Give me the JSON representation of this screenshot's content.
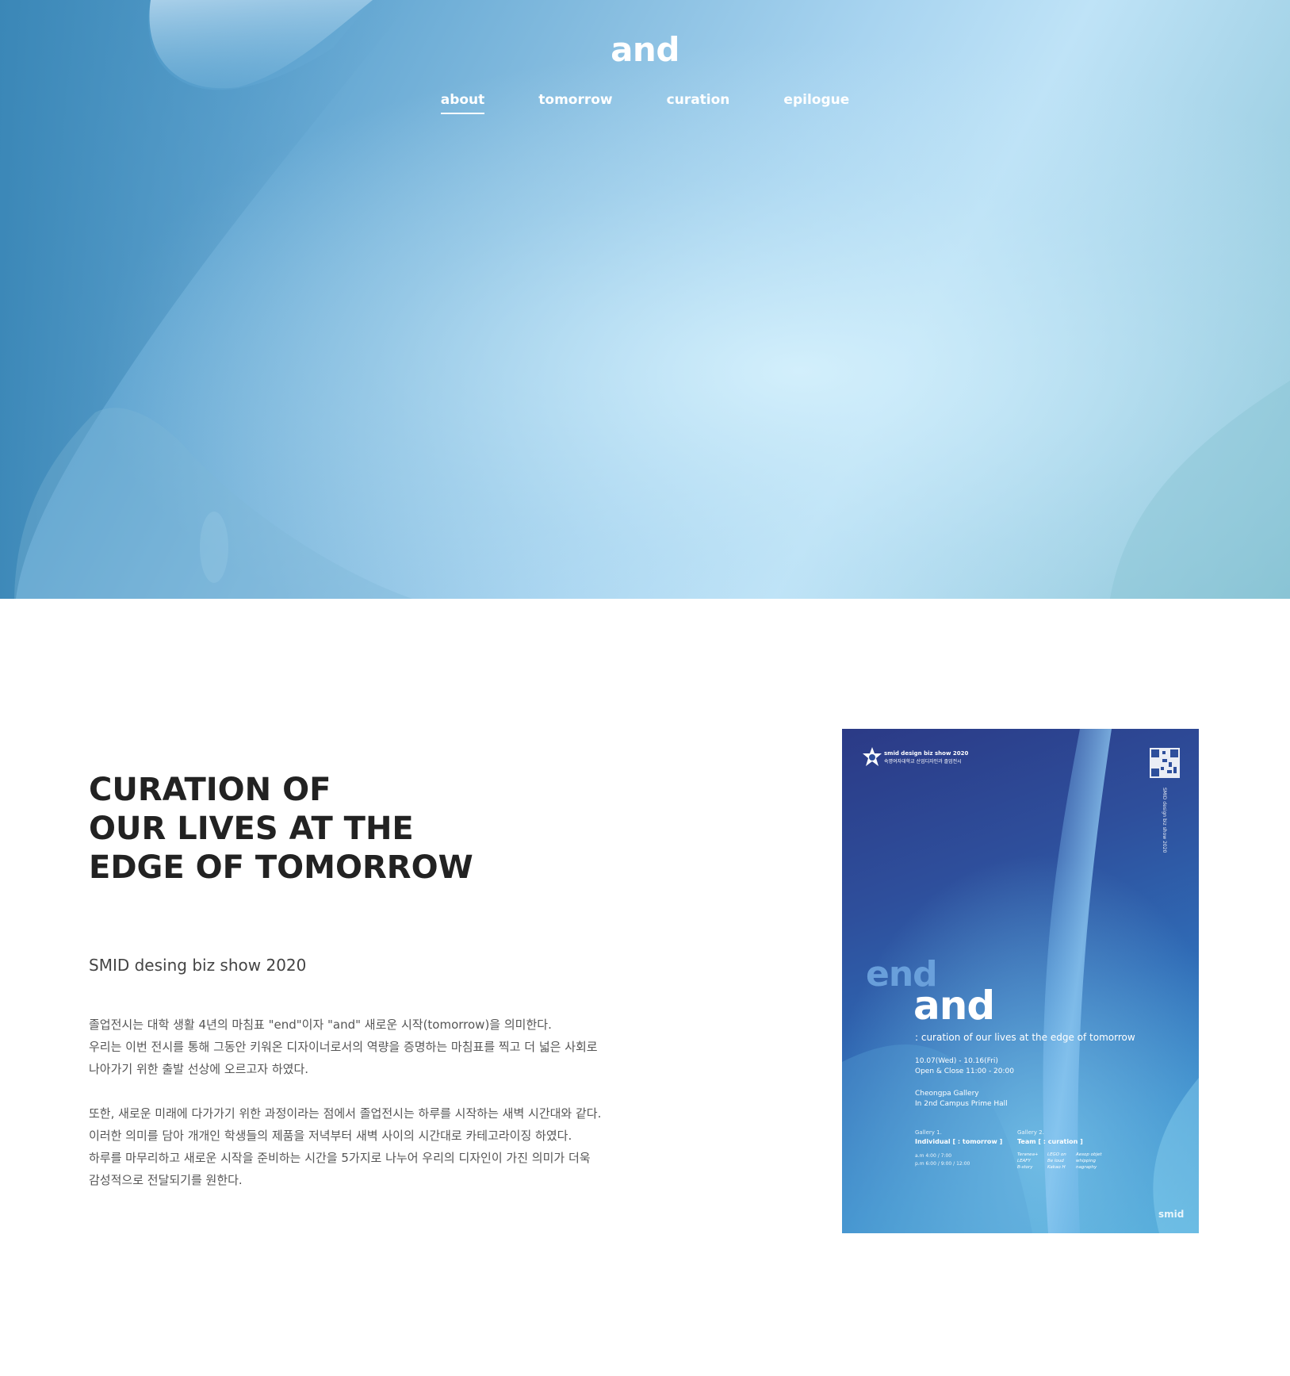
{
  "header": {
    "site_title": "and",
    "nav": [
      {
        "label": "about",
        "active": true
      },
      {
        "label": "tomorrow",
        "active": false
      },
      {
        "label": "curation",
        "active": false
      },
      {
        "label": "epilogue",
        "active": false
      }
    ]
  },
  "content": {
    "heading": "CURATION OF\nOUR LIVES AT THE\nEDGE OF TOMORROW",
    "subtitle": "SMID desing biz show 2020",
    "paragraphs": [
      "졸업전시는 대학 생활 4년의 마침표 \"end\"이자 \"and\" 새로운 시작(tomorrow)을 의미한다.\n우리는 이번 전시를 통해 그동안 키워온 디자이너로서의 역량을 증명하는 마침표를 찍고 더 넓은 사회로\n나아가기 위한 출발 선상에 오르고자 하였다.",
      "또한, 새로운 미래에 다가가기 위한 과정이라는 점에서 졸업전시는 하루를 시작하는 새벽 시간대와 같다.\n이러한 의미를 담아 개개인 학생들의 제품을 저녁부터 새벽 사이의 시간대로 카테고라이징 하였다.\n하루를 마무리하고 새로운 시작을 준비하는 시간을 5가지로 나누어 우리의 디자인이 가진 의미가 더욱\n감성적으로 전달되기를 원한다."
    ]
  },
  "poster": {
    "header_line1": "smid design biz show 2020",
    "header_line2": "숙명여자대학교 산업디자인과 졸업전시",
    "vertical_text": "SMID design biz show 2020",
    "word_end": "end",
    "word_and": "and",
    "tagline": ": curation of our lives at the edge of tomorrow",
    "dates": "10.07(Wed) - 10.16(Fri)",
    "hours": "Open & Close   11:00 - 20:00",
    "venue_line1": "Cheongpa Gallery",
    "venue_line2": "In 2nd Campus Prime Hall",
    "gallery1_label": "Gallery 1.",
    "gallery1_title": "Individual [ : tomorrow ]",
    "gallery1_time1": "a.m 4:00 / 7:00",
    "gallery1_time2": "p.m 6:00 / 9:00 / 12:00",
    "gallery2_label": "Gallery 2.",
    "gallery2_title": "Team [ : curation ]",
    "teams": [
      "Teranea+",
      "LEGO on",
      "Aesop objet",
      "LEAFY",
      "Be loud",
      "whipping",
      "B-story",
      "Kakao H",
      "nagraphy"
    ],
    "brand": "smid"
  },
  "colors": {
    "hero_light": "#c8eaf9",
    "hero_dark": "#3f8fc0",
    "heading_text": "#222222",
    "body_text": "#555555",
    "poster_navy": "#2b3a86",
    "poster_blue": "#3a8ccb"
  }
}
